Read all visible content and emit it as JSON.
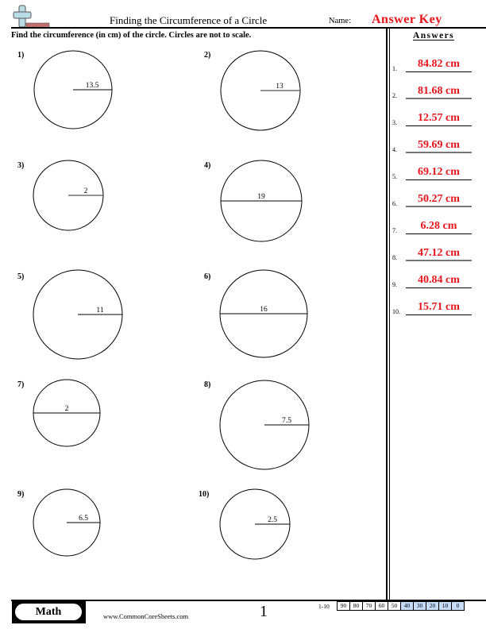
{
  "header": {
    "title": "Finding the Circumference of a Circle",
    "name_label": "Name:",
    "name_value": "Answer Key",
    "logo_icon": "plus-eraser-logo-icon"
  },
  "instructions": "Find the circumference (in cm) of the circle. Circles are not to scale.",
  "answers": {
    "title": "Answers",
    "items": [
      {
        "num": "1.",
        "value": "84.82 cm"
      },
      {
        "num": "2.",
        "value": "81.68 cm"
      },
      {
        "num": "3.",
        "value": "12.57 cm"
      },
      {
        "num": "4.",
        "value": "59.69 cm"
      },
      {
        "num": "5.",
        "value": "69.12 cm"
      },
      {
        "num": "6.",
        "value": "50.27 cm"
      },
      {
        "num": "7.",
        "value": "6.28 cm"
      },
      {
        "num": "8.",
        "value": "47.12 cm"
      },
      {
        "num": "9.",
        "value": "40.84 cm"
      },
      {
        "num": "10.",
        "value": "15.71 cm"
      }
    ]
  },
  "problems": [
    {
      "num": "1)",
      "measure": "radius",
      "label": "13.5"
    },
    {
      "num": "2)",
      "measure": "radius",
      "label": "13"
    },
    {
      "num": "3)",
      "measure": "radius",
      "label": "2"
    },
    {
      "num": "4)",
      "measure": "diameter",
      "label": "19"
    },
    {
      "num": "5)",
      "measure": "radius",
      "label": "11"
    },
    {
      "num": "6)",
      "measure": "diameter",
      "label": "16"
    },
    {
      "num": "7)",
      "measure": "diameter",
      "label": "2"
    },
    {
      "num": "8)",
      "measure": "radius",
      "label": "7.5"
    },
    {
      "num": "9)",
      "measure": "radius",
      "label": "6.5"
    },
    {
      "num": "10)",
      "measure": "radius",
      "label": "2.5"
    }
  ],
  "footer": {
    "subject": "Math",
    "site": "www.CommonCoreSheets.com",
    "page": "1",
    "score_label": "1-10",
    "scores": [
      "90",
      "80",
      "70",
      "60",
      "50",
      "40",
      "30",
      "20",
      "10",
      "0"
    ],
    "highlight_color": "#c6dcf8"
  },
  "colors": {
    "answer_red": "#e8141b",
    "logo_cross": "#b8dde6",
    "logo_eraser": "#c0706c"
  }
}
